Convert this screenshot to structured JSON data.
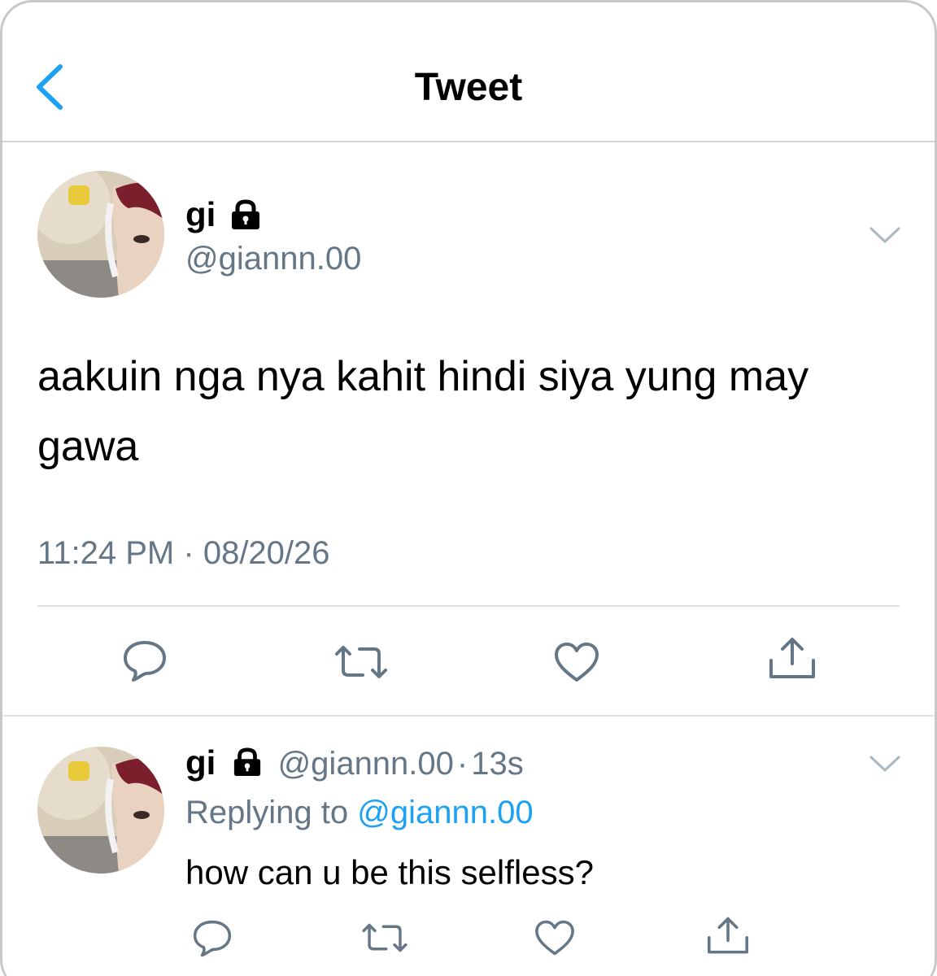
{
  "nav": {
    "title": "Tweet"
  },
  "tweet": {
    "name": "gi",
    "handle": "@giannn.00",
    "text": "aakuin nga nya kahit hindi siya yung may gawa",
    "time": "11:24 PM",
    "separator": "·",
    "date": "08/20/26"
  },
  "reply": {
    "name": "gi",
    "handle": "@giannn.00",
    "separator": "·",
    "age": "13s",
    "replying_prefix": "Replying to",
    "replying_mention": "@giannn.00",
    "text": "how can u be this selfless?"
  },
  "icons": {
    "back": "chevron-left-icon",
    "lock": "lock-icon",
    "more": "chevron-down-icon",
    "reply": "comment-icon",
    "retweet": "retweet-icon",
    "like": "heart-icon",
    "share": "share-icon"
  },
  "colors": {
    "accent": "#1da1f2",
    "secondary_text": "#657786",
    "divider": "#dde1e4"
  }
}
